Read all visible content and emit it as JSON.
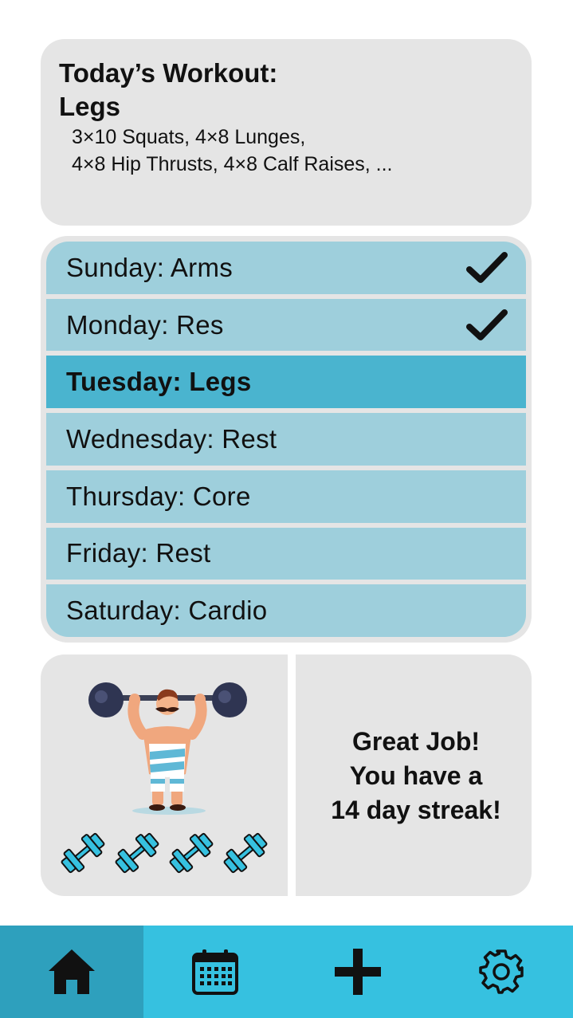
{
  "today": {
    "heading": "Today’s Workout:",
    "workout": "Legs",
    "exercises_line1": "3×10 Squats, 4×8 Lunges,",
    "exercises_line2": "4×8 Hip Thrusts, 4×8 Calf Raises, ..."
  },
  "schedule": {
    "days": [
      {
        "label": "Sunday: Arms",
        "completed": true
      },
      {
        "label": "Monday: Res",
        "completed": true
      },
      {
        "label": "Tuesday: Legs",
        "current": true
      },
      {
        "label": "Wednesday: Rest"
      },
      {
        "label": "Thursday: Core"
      },
      {
        "label": "Friday: Rest"
      },
      {
        "label": "Saturday: Cardio"
      }
    ]
  },
  "streak": {
    "line1": "Great Job!",
    "line2": "You have a",
    "line3": "14 day streak!",
    "dumbbell_count": 4
  },
  "nav": {
    "items": [
      {
        "icon": "home-icon",
        "active": true
      },
      {
        "icon": "calendar-icon"
      },
      {
        "icon": "plus-icon"
      },
      {
        "icon": "gear-icon"
      }
    ]
  },
  "colors": {
    "card_bg": "#e5e5e5",
    "row_bg": "#9ecfdc",
    "row_active": "#4ab4cf",
    "nav_bg": "#36c1e0",
    "nav_active": "#2ea0bd"
  }
}
